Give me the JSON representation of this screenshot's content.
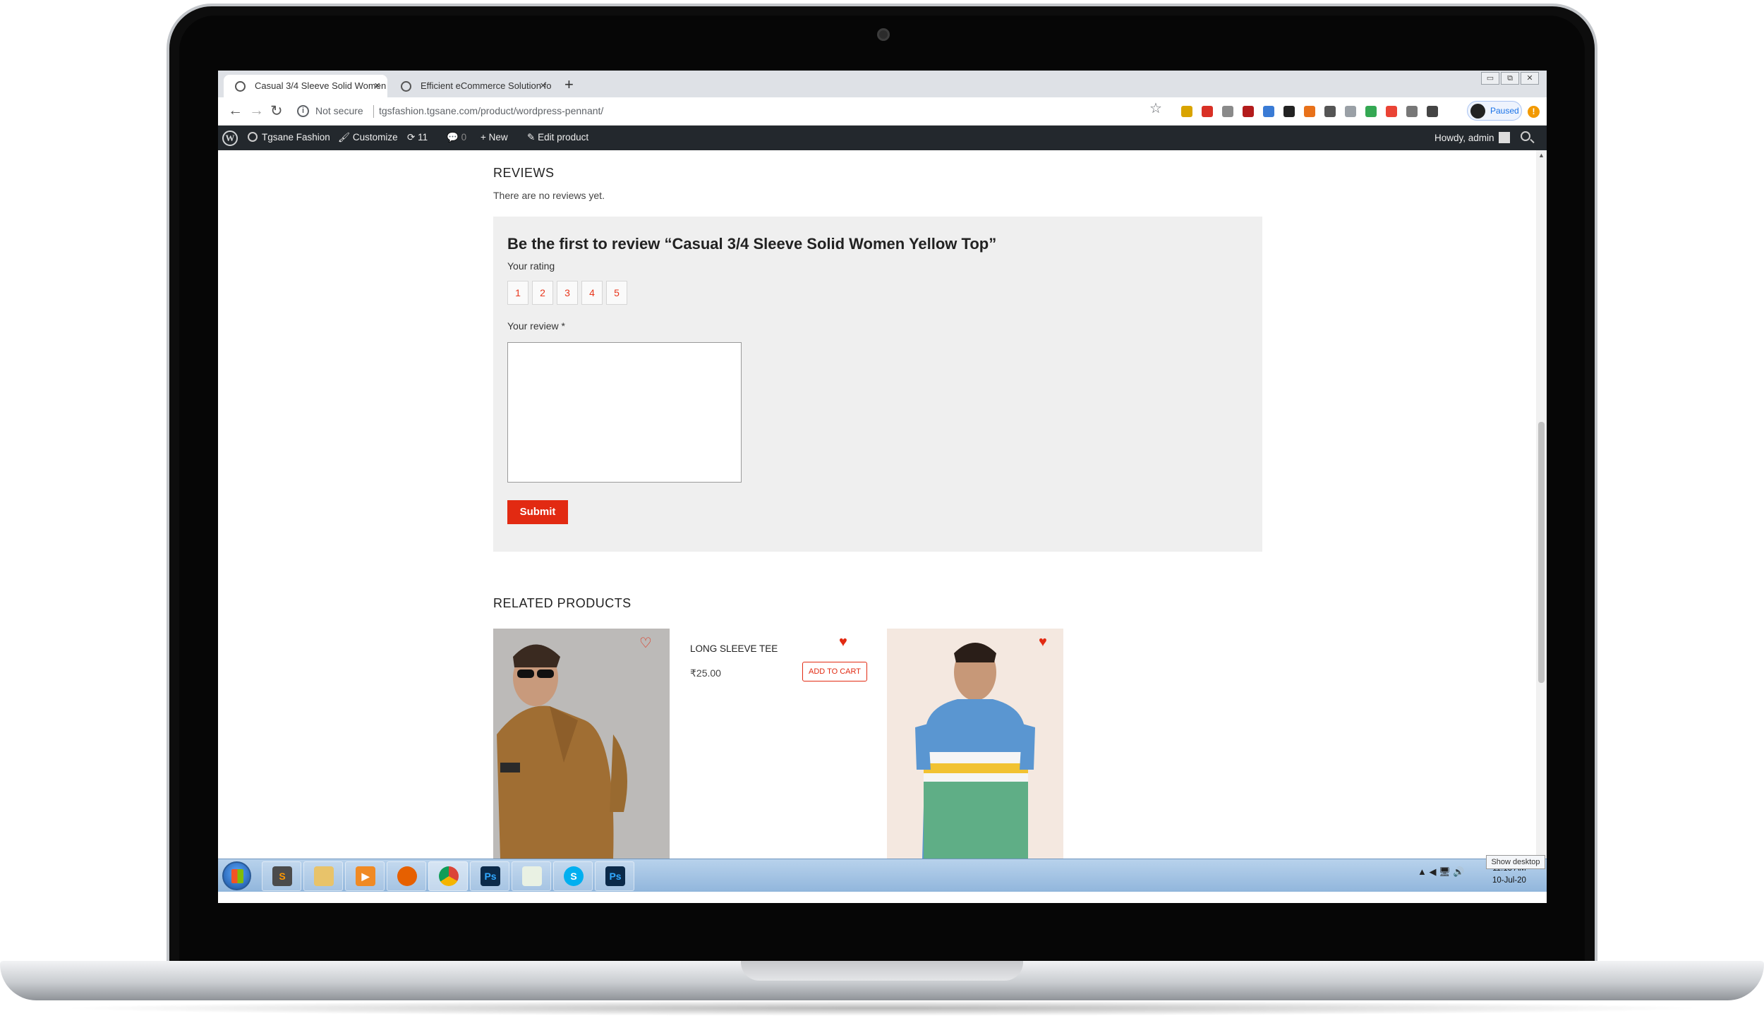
{
  "browser": {
    "tabs": [
      {
        "title": "Casual 3/4 Sleeve Solid Women",
        "close": "×",
        "active": true
      },
      {
        "title": "Efficient eCommerce Solution fo",
        "close": "×",
        "active": false
      }
    ],
    "new_tab": "+",
    "window_controls": [
      "▭",
      "⧉",
      "✕"
    ],
    "info_icon": "i",
    "security_label": "Not secure",
    "url": "tgsfashion.tgsane.com/product/wordpress-pennant/",
    "profile_status": "Paused",
    "alert_badge": "!"
  },
  "admin_bar": {
    "wp_logo": "W",
    "site_name": "Tgsane Fashion",
    "customize": "Customize",
    "updates_count": "11",
    "comments_count": "0",
    "new_label": "New",
    "edit_label": "Edit product",
    "greeting": "Howdy, admin"
  },
  "reviews": {
    "heading": "REVIEWS",
    "empty_message": "There are no reviews yet.",
    "form_title": "Be the first to review “Casual 3/4 Sleeve Solid Women Yellow Top”",
    "rating_label": "Your rating",
    "rating_options": [
      "1",
      "2",
      "3",
      "4",
      "5"
    ],
    "review_label": "Your review *",
    "review_value": "",
    "submit_label": "Submit"
  },
  "related": {
    "heading": "RELATED PRODUCTS",
    "products": [
      {
        "name": "LONG SLEEVE TEE",
        "price": "₹25.00",
        "cta": "ADD TO CART"
      }
    ],
    "heart_outline": "♡",
    "heart_filled": "♥"
  },
  "taskbar": {
    "tray_icons": "▲ ◀ 🖥 🔊",
    "time": "11:13 AM",
    "date": "10-Jul-20",
    "show_desktop": "Show desktop",
    "apps": [
      "start-icon",
      "sublime-icon",
      "explorer-icon",
      "media-player-icon",
      "firefox-icon",
      "chrome-icon",
      "photoshop-icon",
      "charts-icon",
      "skype-icon",
      "photoshop-icon"
    ]
  },
  "colors": {
    "accent": "#e22a12",
    "admin_bar": "#23282d",
    "review_box": "#efefef",
    "taskbar": "#a9c6e6"
  }
}
